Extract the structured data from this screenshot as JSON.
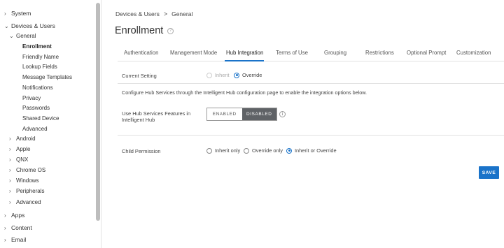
{
  "sidebar": {
    "system": "System",
    "devices_users": "Devices & Users",
    "general": "General",
    "general_items": [
      "Enrollment",
      "Friendly Name",
      "Lookup Fields",
      "Message Templates",
      "Notifications",
      "Privacy",
      "Passwords",
      "Shared Device",
      "Advanced"
    ],
    "platforms": [
      "Android",
      "Apple",
      "QNX",
      "Chrome OS",
      "Windows",
      "Peripherals",
      "Advanced"
    ],
    "apps": "Apps",
    "content": "Content",
    "email": "Email"
  },
  "breadcrumb": {
    "parent": "Devices & Users",
    "sep": ">",
    "current": "General"
  },
  "page_title": "Enrollment",
  "help_glyph": "?",
  "tabs": [
    "Authentication",
    "Management Mode",
    "Hub Integration",
    "Terms of Use",
    "Grouping",
    "Restrictions",
    "Optional Prompt",
    "Customization"
  ],
  "active_tab": "Hub Integration",
  "current_setting": {
    "label": "Current Setting",
    "inherit": "Inherit",
    "override": "Override",
    "selected": "Override"
  },
  "description": "Configure Hub Services through the Intelligent Hub configuration page to enable the integration options below.",
  "hub_services": {
    "label_line1": "Use Hub Services Features in",
    "label_line2": "Intelligent Hub",
    "enabled": "ENABLED",
    "disabled": "DISABLED",
    "selected": "DISABLED",
    "info_glyph": "i"
  },
  "child_permission": {
    "label": "Child Permission",
    "options": [
      "Inherit only",
      "Override only",
      "Inherit or Override"
    ],
    "selected": "Inherit or Override"
  },
  "save_label": "SAVE",
  "accent_color": "#1a73c9"
}
